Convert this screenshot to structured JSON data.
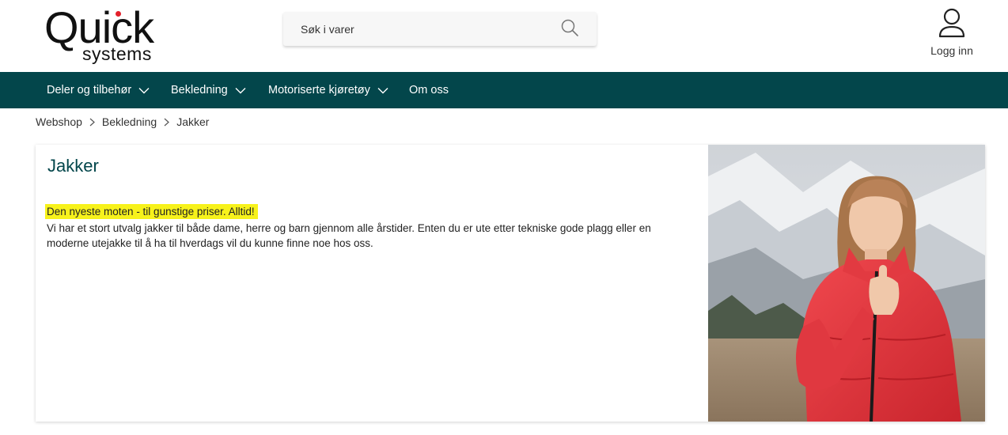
{
  "header": {
    "logo": {
      "top": "Quick",
      "bottom": "systems",
      "dot_color": "#e3202a"
    },
    "search": {
      "placeholder": "Søk i varer",
      "icon": "search-icon"
    },
    "login": {
      "label": "Logg inn",
      "icon": "user-icon"
    }
  },
  "nav": {
    "background": "#03464b",
    "items": [
      {
        "label": "Deler og tilbehør",
        "has_dropdown": true
      },
      {
        "label": "Bekledning",
        "has_dropdown": true
      },
      {
        "label": "Motoriserte kjøretøy",
        "has_dropdown": true
      },
      {
        "label": "Om oss",
        "has_dropdown": false
      }
    ]
  },
  "breadcrumb": [
    "Webshop",
    "Bekledning",
    "Jakker"
  ],
  "content": {
    "title": "Jakker",
    "highlight": "Den nyeste moten - til gunstige priser. Alltid!",
    "description": "Vi har et stort utvalg jakker til både dame, herre og barn gjennom alle årstider. Enten du er ute etter tekniske gode plagg eller en moderne utejakke til å ha til hverdags vil du kunne finne noe hos oss.",
    "highlight_color": "#f7f21b"
  }
}
